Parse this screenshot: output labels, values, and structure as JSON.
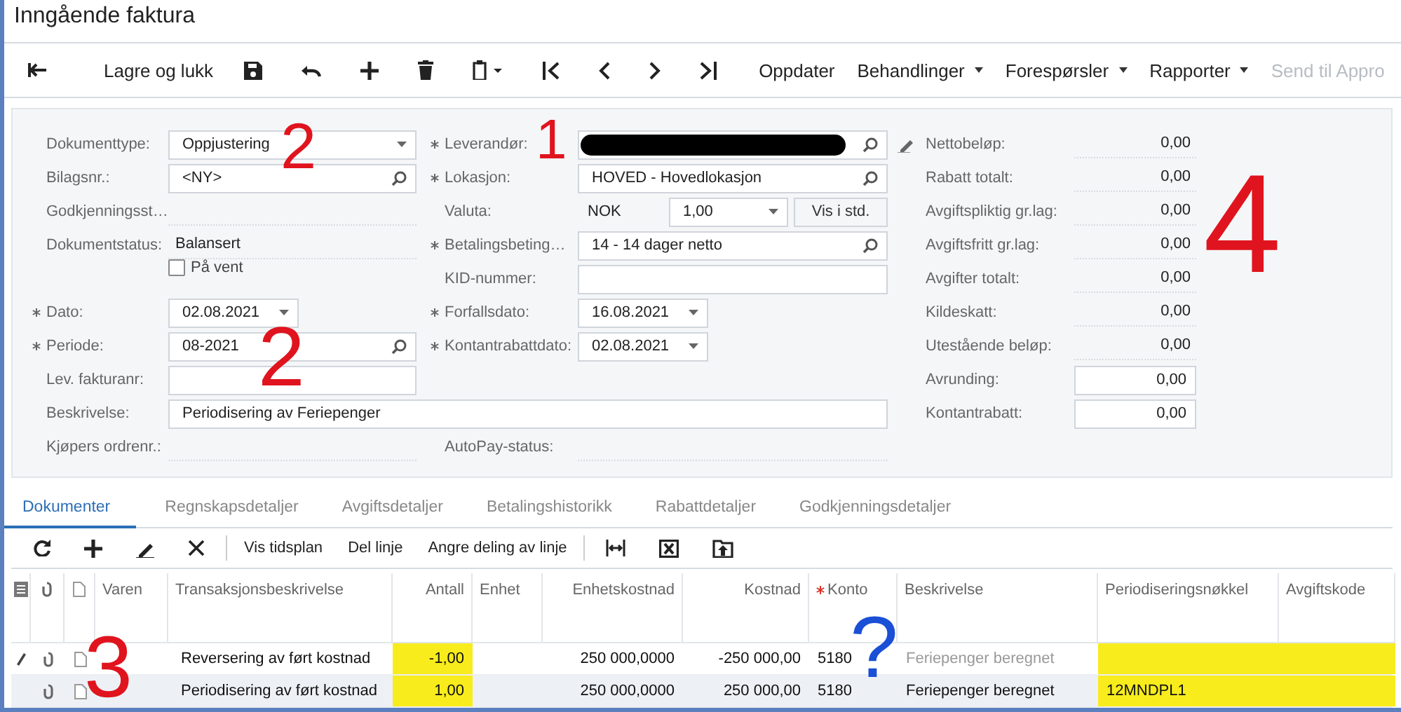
{
  "window": {
    "title": "Inngående faktura"
  },
  "toolbar": [
    {
      "kind": "icon"
    },
    {
      "kind": "text",
      "label": "Lagre og lukk",
      "dropdown": false,
      "disabled": false
    },
    {
      "kind": "icon"
    },
    {
      "kind": "icon"
    },
    {
      "kind": "icon"
    },
    {
      "kind": "icon"
    },
    {
      "kind": "icon"
    },
    {
      "kind": "icon"
    },
    {
      "kind": "icon"
    },
    {
      "kind": "icon"
    },
    {
      "kind": "icon"
    },
    {
      "kind": "text",
      "label": "Oppdater",
      "dropdown": false,
      "disabled": false
    },
    {
      "kind": "text",
      "label": "Behandlinger",
      "dropdown": true,
      "disabled": false
    },
    {
      "kind": "text",
      "label": "Forespørsler",
      "dropdown": true,
      "disabled": false
    },
    {
      "kind": "text",
      "label": "Rapporter",
      "dropdown": true,
      "disabled": false
    },
    {
      "kind": "text",
      "label": "Send til Appro",
      "dropdown": false,
      "disabled": true
    }
  ],
  "form": {
    "left": [
      {
        "kind": "select",
        "label": "Dokumenttype:",
        "required": false,
        "value": "Oppjustering"
      },
      {
        "kind": "lookup",
        "label": "Bilagsnr.:",
        "required": false,
        "value": "<NY>"
      },
      {
        "kind": "readonly",
        "label": "Godkjenningsst…",
        "required": false
      },
      {
        "kind": "readonly",
        "label": "Dokumentstatus:",
        "required": false,
        "value": "Balansert"
      },
      {
        "kind": "checkbox",
        "label": "På vent",
        "checked": false
      },
      {
        "kind": "date",
        "label": "Dato:",
        "required": true,
        "value": "02.08.2021"
      },
      {
        "kind": "lookup",
        "label": "Periode:",
        "required": true,
        "value": "08-2021"
      },
      {
        "kind": "text",
        "label": "Lev. fakturanr:",
        "required": false
      },
      {
        "kind": "wide",
        "label": "Beskrivelse:",
        "required": false,
        "value": "Periodisering av Feriepenger"
      },
      {
        "kind": "readonly",
        "label": "Kjøpers ordrenr.:",
        "required": false
      }
    ],
    "middle": [
      {
        "kind": "lookup",
        "label": "Leverandør:",
        "required": true,
        "redacted": true
      },
      {
        "kind": "lookup",
        "label": "Lokasjon:",
        "required": true,
        "value": "HOVED - Hovedlokasjon",
        "redacted": false
      },
      {
        "kind": "currency",
        "label": "Valuta:",
        "required": false,
        "value": "NOK",
        "rate": "1,00",
        "button": "Vis i std."
      },
      {
        "kind": "lookup",
        "label": "Betalingsbeting…",
        "required": true,
        "value": "14 - 14 dager netto",
        "redacted": false
      },
      {
        "kind": "text",
        "label": "KID-nummer:",
        "required": false
      },
      {
        "kind": "date",
        "label": "Forfallsdato:",
        "required": true,
        "value": "16.08.2021"
      },
      {
        "kind": "date",
        "label": "Kontantrabattdato:",
        "required": true,
        "value": "02.08.2021"
      },
      {
        "kind": "readonly",
        "label": "AutoPay-status:",
        "required": false
      }
    ],
    "right": [
      {
        "kind": "readonly",
        "label": "Nettobeløp:",
        "value": "0,00",
        "editable": true
      },
      {
        "kind": "readonly",
        "label": "Rabatt totalt:",
        "value": "0,00",
        "editable": false
      },
      {
        "kind": "readonly",
        "label": "Avgiftspliktig gr.lag:",
        "value": "0,00",
        "editable": false
      },
      {
        "kind": "readonly",
        "label": "Avgiftsfritt gr.lag:",
        "value": "0,00",
        "editable": false
      },
      {
        "kind": "readonly",
        "label": "Avgifter totalt:",
        "value": "0,00",
        "editable": false
      },
      {
        "kind": "readonly",
        "label": "Kildeskatt:",
        "value": "0,00",
        "editable": false
      },
      {
        "kind": "readonly",
        "label": "Utestående beløp:",
        "value": "0,00",
        "editable": false
      },
      {
        "kind": "input",
        "label": "Avrunding:",
        "value": "0,00",
        "editable": false
      },
      {
        "kind": "input",
        "label": "Kontantrabatt:",
        "value": "0,00",
        "editable": false
      }
    ]
  },
  "tabs": [
    {
      "label": "Dokumenter",
      "selected": true
    },
    {
      "label": "Regnskapsdetaljer",
      "selected": false
    },
    {
      "label": "Avgiftsdetaljer",
      "selected": false
    },
    {
      "label": "Betalingshistorikk",
      "selected": false
    },
    {
      "label": "Rabattdetaljer",
      "selected": false
    },
    {
      "label": "Godkjenningsdetaljer",
      "selected": false
    }
  ],
  "grid_toolbar": [
    {
      "kind": "icon"
    },
    {
      "kind": "icon"
    },
    {
      "kind": "icon"
    },
    {
      "kind": "icon"
    },
    {
      "kind": "divider"
    },
    {
      "kind": "text",
      "label": "Vis tidsplan"
    },
    {
      "kind": "text",
      "label": "Del linje"
    },
    {
      "kind": "text",
      "label": "Angre deling av linje"
    },
    {
      "kind": "divider"
    },
    {
      "kind": "icon"
    },
    {
      "kind": "icon"
    },
    {
      "kind": "icon"
    }
  ],
  "table": {
    "columns": [
      {
        "kind": "icon"
      },
      {
        "kind": "icon"
      },
      {
        "kind": "icon"
      },
      {
        "kind": "text",
        "label": "Varen",
        "required": false
      },
      {
        "kind": "text",
        "label": "Transaksjonsbeskrivelse",
        "required": false
      },
      {
        "kind": "number",
        "label": "Antall",
        "required": false
      },
      {
        "kind": "text",
        "label": "Enhet",
        "required": false
      },
      {
        "kind": "number",
        "label": "Enhetskostnad",
        "required": false
      },
      {
        "kind": "number",
        "label": "Kostnad",
        "required": false
      },
      {
        "kind": "text",
        "label": "Konto",
        "required": true
      },
      {
        "kind": "text",
        "label": "Beskrivelse",
        "required": false
      },
      {
        "kind": "text",
        "label": "Periodiseringsnøkkel",
        "required": false
      },
      {
        "kind": "text",
        "label": "Avgiftskode",
        "required": false
      }
    ],
    "rows": [
      {
        "editing": true,
        "selected": false,
        "cells": [
          {},
          {},
          {},
          {},
          {
            "text": "Reversering av ført kostnad"
          },
          {
            "text": "-1,00",
            "highlighted": true
          },
          {},
          {
            "text": "250 000,0000"
          },
          {
            "text": "-250 000,00"
          },
          {
            "text": "5180"
          },
          {
            "text": "Feriepenger beregnet",
            "disabled": true
          },
          {
            "highlighted": true
          },
          {
            "highlighted": true
          }
        ]
      },
      {
        "editing": false,
        "selected": true,
        "cells": [
          {},
          {},
          {},
          {},
          {
            "text": "Periodisering av ført kostnad"
          },
          {
            "text": "1,00",
            "highlighted": true
          },
          {},
          {
            "text": "250 000,0000"
          },
          {
            "text": "250 000,00"
          },
          {
            "text": "5180"
          },
          {
            "text": "Feriepenger beregnet",
            "disabled": false
          },
          {
            "text": "12MNDPL1",
            "highlighted": true
          },
          {
            "highlighted": true
          }
        ]
      }
    ]
  },
  "annotations": [
    {
      "text": "1",
      "color": "#e0141e"
    },
    {
      "text": "2",
      "color": "#e0141e"
    },
    {
      "text": "4",
      "color": "#e0141e"
    },
    {
      "text": "2",
      "color": "#e0141e"
    },
    {
      "text": "3",
      "color": "#e0141e"
    },
    {
      "text": "?",
      "color": "#1a4fd6"
    }
  ]
}
